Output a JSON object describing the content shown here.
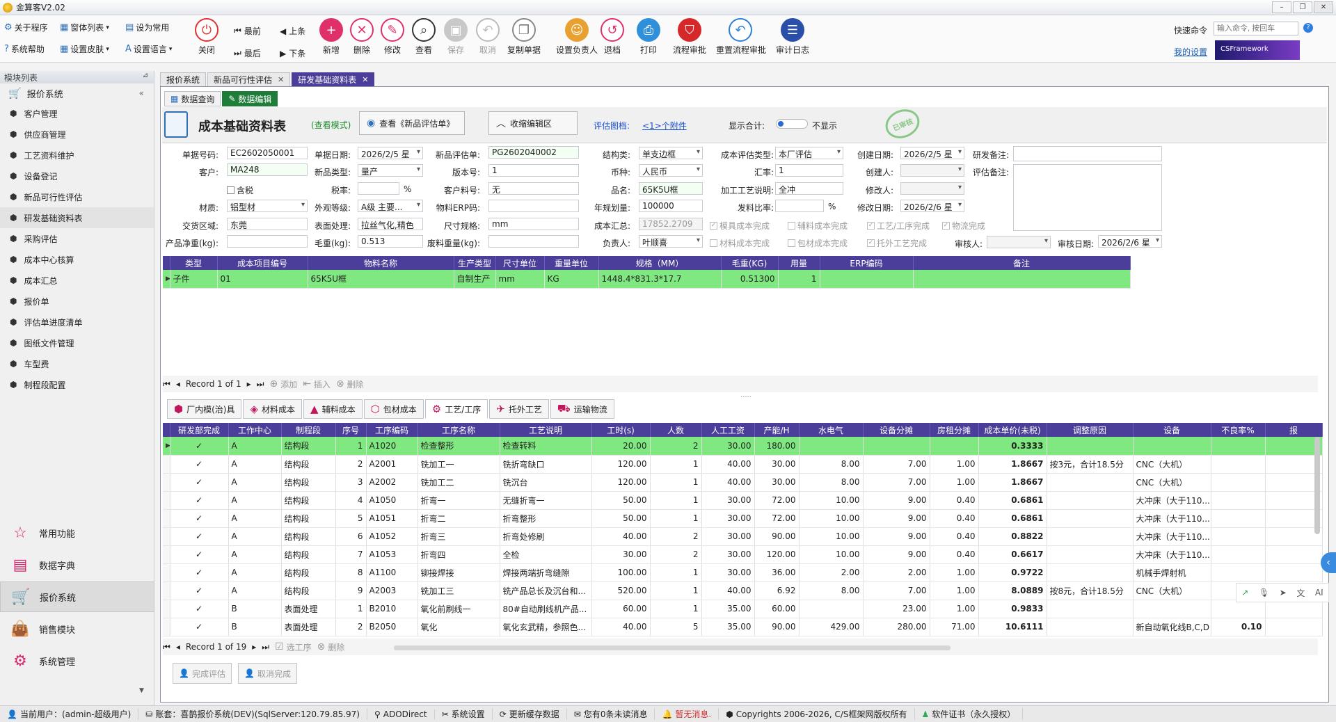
{
  "window": {
    "title": "金算客V2.02"
  },
  "toolbar": {
    "small": [
      {
        "label": "关于程序"
      },
      {
        "label": "窗体列表"
      },
      {
        "label": "设为常用"
      },
      {
        "label": "系统帮助"
      },
      {
        "label": "设置皮肤"
      },
      {
        "label": "设置语言"
      }
    ],
    "close": "关闭",
    "nav": {
      "first": "最前",
      "prev": "上条",
      "last": "最后",
      "next": "下条"
    },
    "big": [
      {
        "label": "新增"
      },
      {
        "label": "删除"
      },
      {
        "label": "修改"
      },
      {
        "label": "查看"
      },
      {
        "label": "保存"
      },
      {
        "label": "取消"
      },
      {
        "label": "复制单据"
      },
      {
        "label": "设置负责人"
      },
      {
        "label": "退档"
      },
      {
        "label": "打印"
      },
      {
        "label": "流程审批"
      },
      {
        "label": "重置流程审批"
      },
      {
        "label": "审计日志"
      }
    ],
    "quick_label": "快速命令",
    "quick_placeholder": "输入命令, 按回车",
    "my_settings": "我的设置",
    "brand": "CSFramework"
  },
  "sidebar": {
    "title": "模块列表",
    "category": "报价系统",
    "items": [
      "客户管理",
      "供应商管理",
      "工艺资料维护",
      "设备登记",
      "新品可行性评估",
      "研发基础资料表",
      "采购评估",
      "成本中心核算",
      "成本汇总",
      "报价单",
      "评估单进度清单",
      "图纸文件管理",
      "车型费",
      "制程段配置"
    ],
    "big": [
      "常用功能",
      "数据字典",
      "报价系统",
      "销售模块",
      "系统管理"
    ]
  },
  "doc_tabs": [
    "报价系统",
    "新品可行性评估",
    "研发基础资料表"
  ],
  "sub_tabs": [
    "数据查询",
    "数据编辑"
  ],
  "header": {
    "title": "成本基础资料表",
    "mode": "(查看模式)",
    "btn_view_eval": "查看《新品评估单》",
    "btn_collapse": "收缩编辑区",
    "eval_drawing_label": "评估图档:",
    "attachment_link": "<1>个附件",
    "show_total_label": "显示合计:",
    "not_show": "不显示",
    "stamp": "已审核"
  },
  "form": {
    "l_docno": "单据号码:",
    "docno": "EC2602050001",
    "l_docdate": "单据日期:",
    "docdate": "2026/2/5 星",
    "l_evalno": "新品评估单:",
    "evalno": "PG2602040002",
    "l_struct": "结构类:",
    "struct": "单支边框",
    "l_costtype": "成本评估类型:",
    "costtype": "本厂评估",
    "l_createdate": "创建日期:",
    "createdate": "2026/2/5 星",
    "l_rdnote": "研发备注:",
    "l_customer": "客户:",
    "customer": "MA248",
    "l_newtype": "新品类型:",
    "newtype": "量产",
    "l_version": "版本号:",
    "version": "1",
    "l_currency": "币种:",
    "currency": "人民币",
    "l_rate": "汇率:",
    "rate": "1",
    "l_creator": "创建人:",
    "l_evalnote": "评估备注:",
    "tax_check": "含税",
    "l_taxrate": "税率:",
    "pct": "%",
    "l_custpart": "客户料号:",
    "custpart": "无",
    "l_partname": "品名:",
    "partname": "65K5U框",
    "l_process": "加工工艺说明:",
    "process": "全冲",
    "l_modifier": "修改人:",
    "l_material": "材质:",
    "material": "铝型材",
    "l_grade": "外观等级:",
    "grade": "A级 主要...",
    "l_erp": "物料ERP码:",
    "l_annual": "年规划量:",
    "annual": "100000",
    "l_issue": "发料比率:",
    "l_moddate": "修改日期:",
    "moddate": "2026/2/6 星",
    "l_region": "交货区域:",
    "region": "东莞",
    "l_surface": "表面处理:",
    "surface": "拉丝气化,精色",
    "l_size": "尺寸规格:",
    "size": "mm",
    "l_costsum": "成本汇总:",
    "costsum": "17852.2709",
    "chk_mold": "模具成本完成",
    "chk_aux": "辅料成本完成",
    "chk_process": "工艺/工序完成",
    "chk_logistics": "物流完成",
    "l_netweight": "产品净重(kg):",
    "l_grossweight": "毛重(kg):",
    "grossweight": "0.513",
    "l_scrap": "废料重量(kg):",
    "l_owner": "负责人:",
    "owner": "叶顺喜",
    "chk_material": "材料成本完成",
    "chk_pack": "包材成本完成",
    "chk_outsource": "托外工艺完成",
    "l_auditor": "审核人:",
    "l_auditdate": "审核日期:",
    "auditdate": "2026/2/6 星"
  },
  "grid1": {
    "headers": [
      "类型",
      "成本项目编号",
      "物料名称",
      "生产类型",
      "尺寸单位",
      "重量单位",
      "规格（MM）",
      "毛重(KG)",
      "用量",
      "ERP编码",
      "备注"
    ],
    "rows": [
      [
        "子件",
        "01",
        "65K5U框",
        "自制生产",
        "mm",
        "KG",
        "1448.4*831.3*17.7",
        "0.51300",
        "1",
        "",
        ""
      ]
    ]
  },
  "nav1": {
    "record": "Record 1 of 1",
    "add": "添加",
    "insert": "插入",
    "delete": "删除"
  },
  "bottom_tabs": [
    "厂内模(治)具",
    "材料成本",
    "辅料成本",
    "包材成本",
    "工艺/工序",
    "托外工艺",
    "运输物流"
  ],
  "grid2": {
    "headers": [
      "研发部完成",
      "工作中心",
      "制程段",
      "序号",
      "工序编码",
      "工序名称",
      "工艺说明",
      "工时(s)",
      "人数",
      "人工工资",
      "产能/H",
      "水电气",
      "设备分摊",
      "房租分摊",
      "成本单价(未税)",
      "调整原因",
      "设备",
      "不良率%",
      "报"
    ],
    "rows": [
      [
        "✓",
        "A",
        "结构段",
        "1",
        "A1020",
        "检查整形",
        "检查转料",
        "20.00",
        "2",
        "30.00",
        "180.00",
        "",
        "",
        "",
        "0.3333",
        "",
        "",
        "",
        ""
      ],
      [
        "✓",
        "A",
        "结构段",
        "2",
        "A2001",
        "铣加工一",
        "铣折弯缺口",
        "120.00",
        "1",
        "40.00",
        "30.00",
        "8.00",
        "7.00",
        "1.00",
        "1.8667",
        "按3元，合计18.5分",
        "CNC（大机）",
        "",
        ""
      ],
      [
        "✓",
        "A",
        "结构段",
        "3",
        "A2002",
        "铣加工二",
        "铣沉台",
        "120.00",
        "1",
        "40.00",
        "30.00",
        "8.00",
        "7.00",
        "1.00",
        "1.8667",
        "",
        "CNC（大机）",
        "",
        ""
      ],
      [
        "✓",
        "A",
        "结构段",
        "4",
        "A1050",
        "折弯一",
        "无缝折弯一",
        "50.00",
        "1",
        "30.00",
        "72.00",
        "10.00",
        "9.00",
        "0.40",
        "0.6861",
        "",
        "大冲床（大于110...",
        "",
        ""
      ],
      [
        "✓",
        "A",
        "结构段",
        "5",
        "A1051",
        "折弯二",
        "折弯整形",
        "50.00",
        "1",
        "30.00",
        "72.00",
        "10.00",
        "9.00",
        "0.40",
        "0.6861",
        "",
        "大冲床（大于110...",
        "",
        ""
      ],
      [
        "✓",
        "A",
        "结构段",
        "6",
        "A1052",
        "折弯三",
        "折弯处修刷",
        "40.00",
        "2",
        "30.00",
        "90.00",
        "10.00",
        "9.00",
        "0.40",
        "0.8822",
        "",
        "大冲床（大于110...",
        "",
        ""
      ],
      [
        "✓",
        "A",
        "结构段",
        "7",
        "A1053",
        "折弯四",
        "全检",
        "30.00",
        "2",
        "30.00",
        "120.00",
        "10.00",
        "9.00",
        "0.40",
        "0.6617",
        "",
        "大冲床（大于110...",
        "",
        ""
      ],
      [
        "✓",
        "A",
        "结构段",
        "8",
        "A1100",
        "铆接焊接",
        "焊接两端折弯缝隙",
        "100.00",
        "1",
        "30.00",
        "36.00",
        "2.00",
        "2.00",
        "1.00",
        "0.9722",
        "",
        "机械手焊射机",
        "",
        ""
      ],
      [
        "✓",
        "A",
        "结构段",
        "9",
        "A2003",
        "铣加工三",
        "铣产品总长及沉台和...",
        "520.00",
        "1",
        "40.00",
        "6.92",
        "8.00",
        "7.00",
        "1.00",
        "8.0889",
        "按8元，合计18.5分",
        "CNC（大机）",
        "",
        ""
      ],
      [
        "✓",
        "B",
        "表面处理",
        "1",
        "B2010",
        "氧化前刷线一",
        "80#自动刷线机产品...",
        "60.00",
        "1",
        "35.00",
        "60.00",
        "",
        "23.00",
        "1.00",
        "0.9833",
        "",
        "",
        "",
        ""
      ],
      [
        "✓",
        "B",
        "表面处理",
        "2",
        "B2050",
        "氧化",
        "氧化玄武精，参照色...",
        "40.00",
        "5",
        "35.00",
        "90.00",
        "429.00",
        "280.00",
        "71.00",
        "10.6111",
        "",
        "新自动氧化线B,C,D",
        "0.10",
        ""
      ]
    ]
  },
  "nav2": {
    "record": "Record 1 of 19",
    "select": "选工序",
    "delete": "删除"
  },
  "actions": {
    "complete": "完成评估",
    "cancel": "取消完成"
  },
  "status": {
    "user": "当前用户：(admin-超级用户)",
    "account": "账套：喜鹊报价系统(DEV)(SqlServer:120.79.85.97)",
    "ado": "ADODirect",
    "settings": "系统设置",
    "refresh": "更新缓存数据",
    "messages": "您有0条未读消息",
    "alert": "暂无消息.",
    "copyright": "Copyrights 2006-2026, C/S框架网版权所有",
    "license": "软件证书（永久授权）"
  }
}
